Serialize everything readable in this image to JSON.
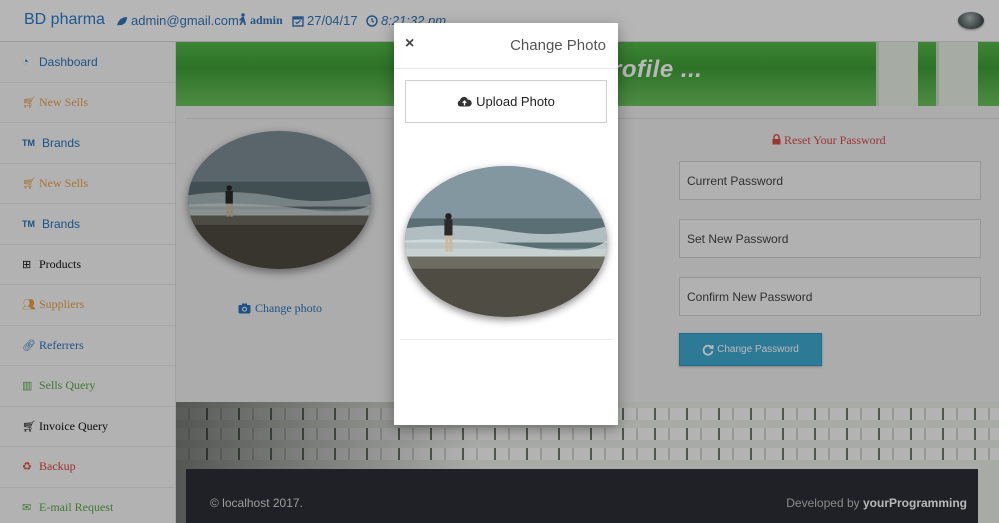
{
  "header": {
    "brand": "BD pharma",
    "email": "admin@gmail.com",
    "user": "admin",
    "date": "27/04/17",
    "time": "8:21:32 pm"
  },
  "sidebar": {
    "items": [
      {
        "label": "Dashboard",
        "icon": "dashboard-icon",
        "color": "#2a72ba"
      },
      {
        "label": "New Sells",
        "icon": "cart-icon",
        "color": "#e5a24a"
      },
      {
        "label": "Brands",
        "icon": "trademark-icon",
        "color": "#2a72ba"
      },
      {
        "label": "New Sells",
        "icon": "cart-icon",
        "color": "#e5a24a"
      },
      {
        "label": "Brands",
        "icon": "trademark-icon",
        "color": "#2a72ba"
      },
      {
        "label": "Products",
        "icon": "basket-icon",
        "color": "#111111"
      },
      {
        "label": "Suppliers",
        "icon": "users-icon",
        "color": "#e5a24a"
      },
      {
        "label": "Referrers",
        "icon": "link-icon",
        "color": "#2a72ba"
      },
      {
        "label": "Sells Query",
        "icon": "bar-chart-icon",
        "color": "#5aa84c"
      },
      {
        "label": "Invoice Query",
        "icon": "cart-icon",
        "color": "#111111"
      },
      {
        "label": "Backup",
        "icon": "recycle-icon",
        "color": "#d8453b"
      },
      {
        "label": "E-mail Request",
        "icon": "envelope-icon",
        "color": "#5aa84c"
      }
    ]
  },
  "main": {
    "banner_title": "rofile ...",
    "change_photo_link": "Change photo",
    "reset_title": "Reset Your Password",
    "fields": {
      "current": "Current Password",
      "new": "Set New Password",
      "confirm": "Confirm New Password"
    },
    "change_password_button": "Change Password"
  },
  "modal": {
    "close": "×",
    "title": "Change Photo",
    "upload_button": "Upload Photo"
  },
  "footer": {
    "copyright": "© localhost 2017.",
    "developed_by": "Developed by",
    "developer": "yourProgramming"
  },
  "colors": {
    "link_blue": "#2a72ba",
    "button_blue": "#3fa9d2",
    "banner_green": "#3fa037",
    "footer_dark": "#2b2f35"
  }
}
